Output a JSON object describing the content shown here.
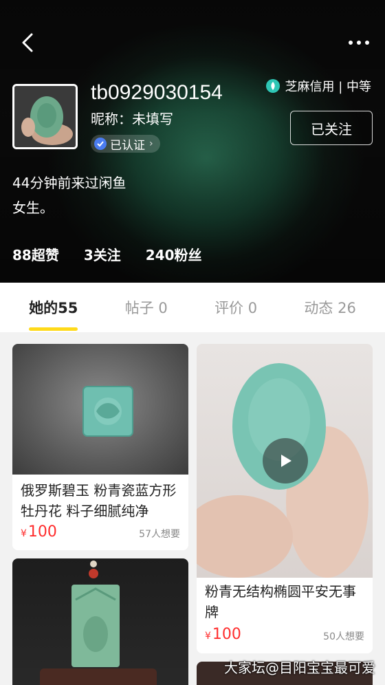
{
  "header": {
    "username": "tb0929030154",
    "nickname": "昵称：未填写",
    "verified_label": "已认证",
    "credit_label": "芝麻信用 | 中等",
    "follow_label": "已关注",
    "last_seen": "44分钟前来过闲鱼",
    "bio": "女生。",
    "stats": [
      "88超赞",
      "3关注",
      "240粉丝"
    ]
  },
  "tabs": [
    {
      "label": "她的55",
      "active": true
    },
    {
      "label": "帖子 0",
      "active": false
    },
    {
      "label": "评价 0",
      "active": false
    },
    {
      "label": "动态 26",
      "active": false
    }
  ],
  "items": [
    {
      "title": "俄罗斯碧玉 粉青瓷蓝方形牡丹花 料子细腻纯净",
      "price": "100",
      "currency": "¥",
      "wants": "57人想要"
    },
    {
      "title": "粉青无结构椭圆平安无事牌",
      "price": "100",
      "currency": "¥",
      "wants": "50人想要",
      "video": true
    }
  ],
  "watermark": "大家坛@目阳宝宝最可爱",
  "colors": {
    "accent": "#ffda1a",
    "price": "#ff2d2d",
    "jade": "#5fb5a0"
  }
}
